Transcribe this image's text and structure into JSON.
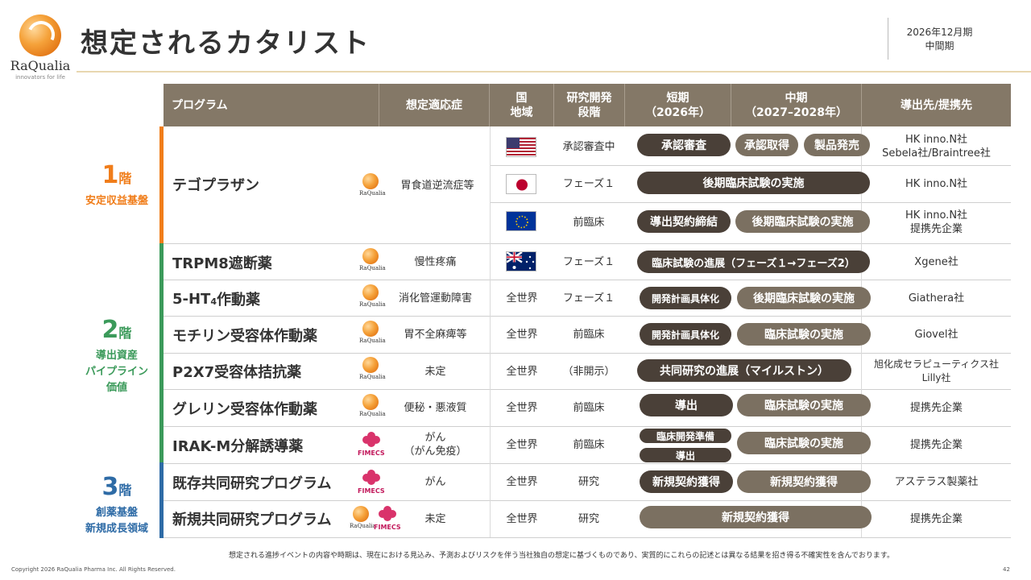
{
  "header": {
    "logo_name": "RaQualia",
    "logo_tagline": "innovators for life",
    "title": "想定されるカタリスト",
    "period_line1": "2026年12月期",
    "period_line2": "中間期"
  },
  "tiers": [
    {
      "num": "1",
      "suffix": "階",
      "desc": "安定収益基盤",
      "color": "#f07d1a"
    },
    {
      "num": "2",
      "suffix": "階",
      "desc": "導出資産\nパイプライン\n価値",
      "color": "#3b9a5a"
    },
    {
      "num": "3",
      "suffix": "階",
      "desc": "創薬基盤\n新規成長領域",
      "color": "#2e6ba6"
    }
  ],
  "table_header": {
    "program": "プログラム",
    "indication": "想定適応症",
    "region": "国\n地域",
    "stage": "研究開発\n段階",
    "short_term": "短期\n（2026年）",
    "mid_term": "中期\n（2027–2028年）",
    "partner": "導出先/提携先"
  },
  "logos": {
    "raqualia_mini": "RaQualia",
    "fimecs": "FIMECS"
  },
  "rows": {
    "tegoprazan": {
      "program": "テゴプラザン",
      "indication": "胃食道逆流症等",
      "sub": [
        {
          "flag": "us-flag",
          "stage": "承認審査中",
          "pills": [
            "承認審査",
            "承認取得",
            "製品発売"
          ],
          "partner": "HK inno.N社\nSebela社/Braintree社"
        },
        {
          "flag": "japan-flag",
          "stage": "フェーズ１",
          "pills": [
            "後期臨床試験の実施"
          ],
          "partner": "HK inno.N社"
        },
        {
          "flag": "eu-flag",
          "stage": "前臨床",
          "pills": [
            "導出契約締結",
            "後期臨床試験の実施"
          ],
          "partner": "HK inno.N社\n提携先企業"
        }
      ]
    },
    "trpm8": {
      "program": "TRPM8遮断薬",
      "indication": "慢性疼痛",
      "flag": "australia-flag",
      "stage": "フェーズ１",
      "pill": "臨床試験の進展（フェーズ１→フェーズ2）",
      "partner": "Xgene社"
    },
    "ht4": {
      "program_main": "5-HT",
      "program_sub": "4",
      "program_tail": "作動薬",
      "indication": "消化管運動障害",
      "region": "全世界",
      "stage": "フェーズ１",
      "pill_short": "開発計画具体化",
      "pill_mid": "後期臨床試験の実施",
      "partner": "Giathera社"
    },
    "motilin": {
      "program": "モチリン受容体作動薬",
      "indication": "胃不全麻痺等",
      "region": "全世界",
      "stage": "前臨床",
      "pill_short": "開発計画具体化",
      "pill_mid": "臨床試験の実施",
      "partner": "Giovel社"
    },
    "p2x7": {
      "program": "P2X7受容体拮抗薬",
      "indication": "未定",
      "region": "全世界",
      "stage": "（非開示）",
      "pill": "共同研究の進展（マイルストン）",
      "partner": "旭化成セラピューティクス社\nLilly社"
    },
    "ghrelin": {
      "program": "グレリン受容体作動薬",
      "indication": "便秘・悪液質",
      "region": "全世界",
      "stage": "前臨床",
      "pill_short": "導出",
      "pill_mid": "臨床試験の実施",
      "partner": "提携先企業"
    },
    "irakm": {
      "program": "IRAK-M分解誘導薬",
      "indication": "がん\n（がん免疫）",
      "region": "全世界",
      "stage": "前臨床",
      "pill_short_top": "臨床開発準備",
      "pill_short_bottom": "導出",
      "pill_mid": "臨床試験の実施",
      "partner": "提携先企業"
    },
    "existing": {
      "program": "既存共同研究プログラム",
      "indication": "がん",
      "region": "全世界",
      "stage": "研究",
      "pill_short": "新規契約獲得",
      "pill_mid": "新規契約獲得",
      "partner": "アステラス製薬社"
    },
    "new": {
      "program": "新規共同研究プログラム",
      "indication": "未定",
      "region": "全世界",
      "stage": "研究",
      "pill": "新規契約獲得",
      "partner": "提携先企業"
    }
  },
  "footer": {
    "note": "想定される進捗イベントの内容や時期は、現在における見込み、予測およびリスクを伴う当社独自の想定に基づくものであり、実質的にこれらの記述とは異なる結果を招き得る不確実性を含んでおります。",
    "copyright": "Copyright 2026 RaQualia Pharma Inc. All Rights Reserved.",
    "page": "42"
  },
  "colors": {
    "header_bg": "#847867",
    "pill_dark": "#4a4038",
    "pill_mid": "#7b7061",
    "tier1": "#f07d1a",
    "tier2": "#3b9a5a",
    "tier3": "#2e6ba6"
  }
}
